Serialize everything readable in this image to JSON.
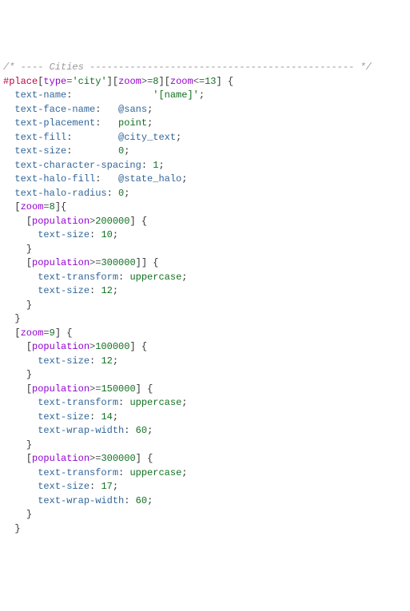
{
  "header_comment": "/* ---- Cities ---------------------------------------------- */",
  "rule": {
    "selector": {
      "hash": "#place",
      "filters": [
        {
          "key": "type",
          "op": "=",
          "value": "'city'"
        },
        {
          "key": "zoom",
          "op": ">=",
          "value": "8"
        },
        {
          "key": "zoom",
          "op": "<=",
          "value": "13"
        }
      ]
    },
    "decls": [
      {
        "prop": "text-name",
        "value": "'[name]'",
        "kind": "quote",
        "pad": 14
      },
      {
        "prop": "text-face-name",
        "value": "@sans",
        "kind": "var",
        "pad": 3
      },
      {
        "prop": "text-placement",
        "value": "point",
        "kind": "val",
        "pad": 3
      },
      {
        "prop": "text-fill",
        "value": "@city_text",
        "kind": "var",
        "pad": 8
      },
      {
        "prop": "text-size",
        "value": "0",
        "kind": "num",
        "pad": 8
      },
      {
        "prop": "text-character-spacing",
        "value": "1",
        "kind": "num",
        "pad": 1
      },
      {
        "prop": "text-halo-fill",
        "value": "@state_halo",
        "kind": "var",
        "pad": 3
      },
      {
        "prop": "text-halo-radius",
        "value": "0",
        "kind": "num",
        "pad": 1
      }
    ],
    "zoom8": {
      "filter": {
        "key": "zoom",
        "op": "=",
        "value": "8"
      },
      "blocks": [
        {
          "filter": {
            "key": "population",
            "op": ">",
            "value": "200000"
          },
          "decls": [
            {
              "prop": "text-size",
              "value": "10",
              "kind": "num",
              "pad": 1
            }
          ]
        },
        {
          "filter": {
            "key": "population",
            "op": ">=",
            "value": "300000"
          },
          "bracket_inner": true,
          "decls": [
            {
              "prop": "text-transform",
              "value": "uppercase",
              "kind": "val",
              "pad": 1
            },
            {
              "prop": "text-size",
              "value": "12",
              "kind": "num",
              "pad": 1
            }
          ]
        }
      ]
    },
    "zoom9": {
      "filter": {
        "key": "zoom",
        "op": "=",
        "value": "9"
      },
      "blocks": [
        {
          "filter": {
            "key": "population",
            "op": ">",
            "value": "100000"
          },
          "decls": [
            {
              "prop": "text-size",
              "value": "12",
              "kind": "num",
              "pad": 1
            }
          ]
        },
        {
          "filter": {
            "key": "population",
            "op": ">=",
            "value": "150000"
          },
          "decls": [
            {
              "prop": "text-transform",
              "value": "uppercase",
              "kind": "val",
              "pad": 1
            },
            {
              "prop": "text-size",
              "value": "14",
              "kind": "num",
              "pad": 1
            },
            {
              "prop": "text-wrap-width",
              "value": "60",
              "kind": "num",
              "pad": 1
            }
          ]
        },
        {
          "filter": {
            "key": "population",
            "op": ">=",
            "value": "300000"
          },
          "decls": [
            {
              "prop": "text-transform",
              "value": "uppercase",
              "kind": "val",
              "pad": 1
            },
            {
              "prop": "text-size",
              "value": "17",
              "kind": "num",
              "pad": 1
            },
            {
              "prop": "text-wrap-width",
              "value": "60",
              "kind": "num",
              "pad": 1
            }
          ]
        }
      ]
    }
  }
}
